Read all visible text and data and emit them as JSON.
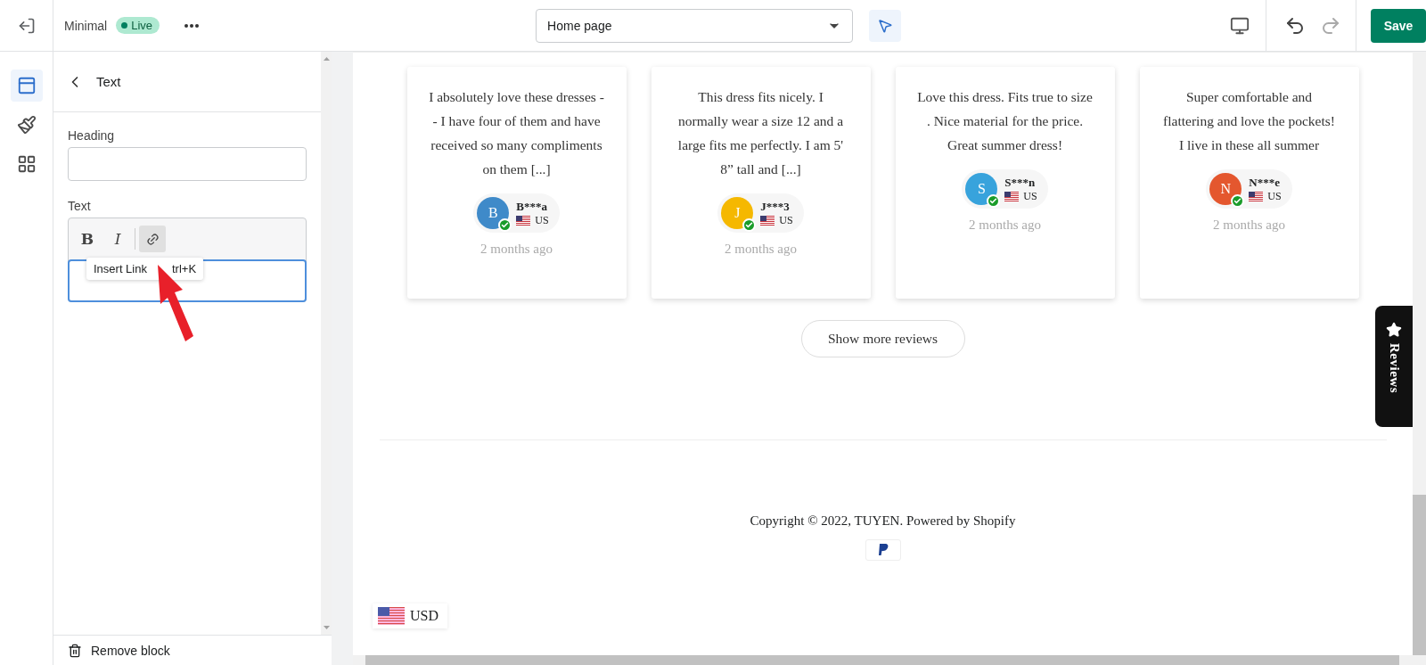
{
  "topbar": {
    "theme_name": "Minimal",
    "status": "Live",
    "page_select": {
      "value": "Home page"
    },
    "save_label": "Save"
  },
  "rail": [
    {
      "kind": "sections",
      "selected": true
    },
    {
      "kind": "theme",
      "selected": false
    },
    {
      "kind": "apps",
      "selected": false
    }
  ],
  "panel": {
    "title": "Text",
    "fields": [
      {
        "label": "Heading",
        "kind": "input"
      },
      {
        "label": "Text",
        "kind": "richtext"
      }
    ],
    "toolbar": [
      {
        "kind": "bold",
        "label": "B",
        "active": false
      },
      {
        "kind": "italic",
        "label": "I",
        "active": false
      },
      {
        "kind": "link",
        "active": true
      }
    ],
    "tooltip": {
      "label": "Insert Link",
      "shortcut": "trl+K"
    },
    "remove_label": "Remove block"
  },
  "reviews": [
    {
      "text": "I absolutely love these dresses -- I have four of them and have received so many compliments on them [...]",
      "initial": "B",
      "name": "B***a",
      "country": "US",
      "color": "#3f8ac9",
      "time": "2 months ago"
    },
    {
      "text": "This dress fits nicely. I normally wear a size 12 and a large fits me perfectly. I am 5' 8” tall and [...]",
      "initial": "J",
      "name": "J***3",
      "country": "US",
      "color": "#f5b800",
      "time": "2 months ago"
    },
    {
      "text": "Love this dress. Fits true to size . Nice material for the price. Great summer dress!",
      "initial": "S",
      "name": "S***n",
      "country": "US",
      "color": "#38a3dc",
      "time": "2 months ago"
    },
    {
      "text": "Super comfortable and flattering and love the pockets! I live in these all summer",
      "initial": "N",
      "name": "N***e",
      "country": "US",
      "color": "#e4572e",
      "time": "2 months ago"
    }
  ],
  "show_more": "Show more reviews",
  "reviews_tab": "Reviews",
  "copyright": "Copyright © 2022, TUYEN. Powered by Shopify",
  "currency": "USD"
}
